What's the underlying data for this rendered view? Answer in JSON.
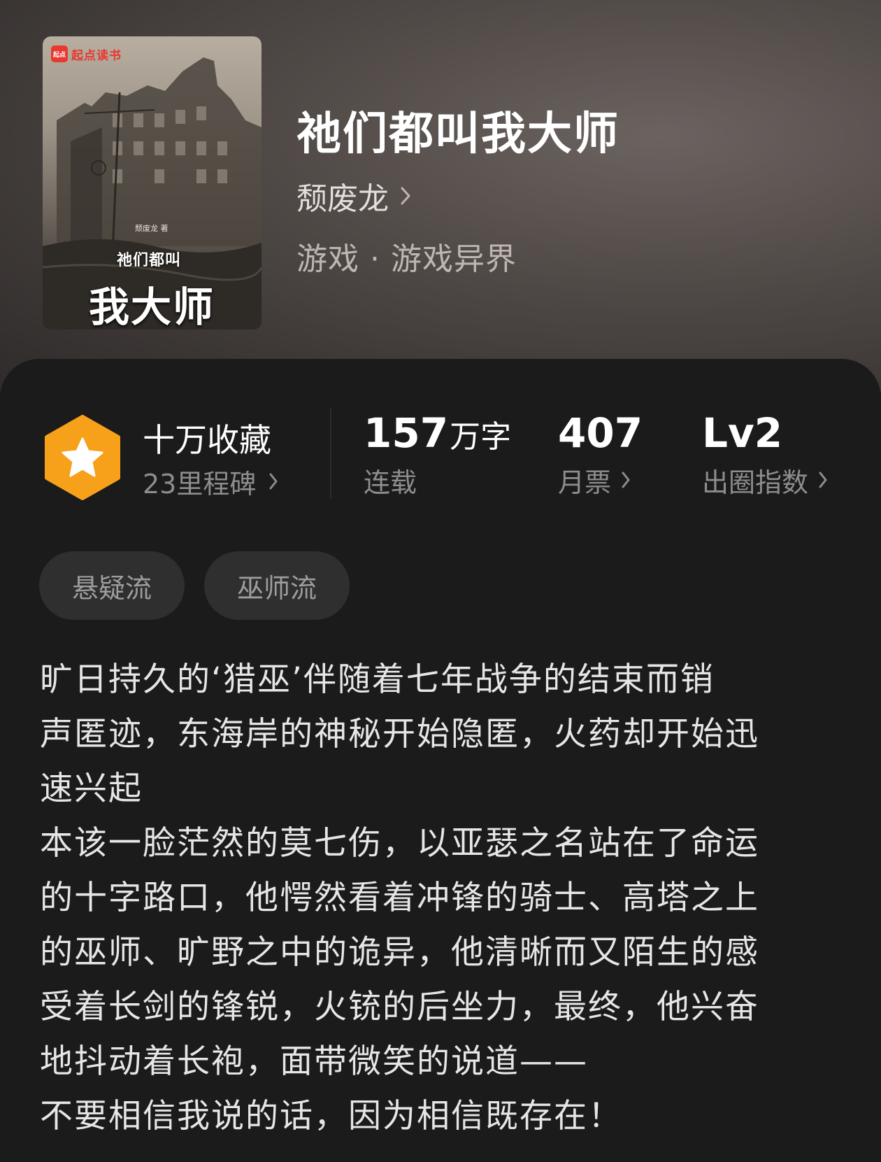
{
  "book": {
    "title": "祂们都叫我大师",
    "author": "颓废龙",
    "genre": "游戏 · 游戏异界",
    "cover": {
      "brand": "起点读书",
      "brand_badge": "起点",
      "author_line": "颓废龙 著",
      "title_line1": "祂们都叫",
      "title_line2": "我大师"
    }
  },
  "stats": {
    "favorites": {
      "label": "十万收藏",
      "milestones": "23里程碑"
    },
    "words": {
      "value": "157",
      "unit": "万字",
      "status": "连载"
    },
    "monthly_tickets": {
      "value": "407",
      "label": "月票"
    },
    "breakout_index": {
      "value": "Lv2",
      "label": "出圈指数"
    }
  },
  "tags": [
    "悬疑流",
    "巫师流"
  ],
  "synopsis": {
    "lines": [
      "旷日持久的‘猎巫’伴随着七年战争的结束而销",
      "声匿迹，东海岸的神秘开始隐匿，火药却开始迅",
      "速兴起",
      "本该一脸茫然的莫七伤，以亚瑟之名站在了命运",
      "的十字路口，他愕然看着冲锋的骑士、高塔之上",
      "的巫师、旷野之中的诡异，他清晰而又陌生的感",
      "受着长剑的锋锐，火铳的后坐力，最终，他兴奋",
      "地抖动着长袍，面带微笑的说道——",
      "不要相信我说的话，因为相信既存在！"
    ]
  },
  "colors": {
    "badge_orange": "#f7a11a",
    "badge_star": "#ffffff",
    "panel_bg": "#1b1b1b",
    "tag_bg": "#2f2f2f"
  }
}
